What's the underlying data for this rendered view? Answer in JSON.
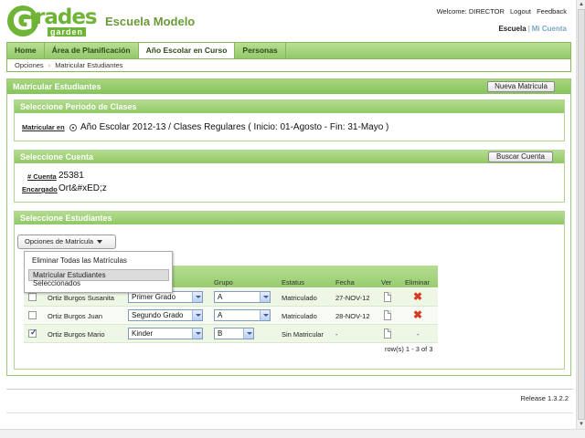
{
  "brand": {
    "logo_letter": "G",
    "logo_main": "rades",
    "logo_sub": "garden",
    "school_name": "Escuela Modelo"
  },
  "topbar": {
    "welcome": "Welcome: DIRECTOR",
    "logout": "Logout",
    "feedback": "Feedback"
  },
  "switcher": {
    "current": "Escuela",
    "separator": "|",
    "other": "Mi Cuenta"
  },
  "nav": {
    "tabs": [
      "Home",
      "Área de Planificación",
      "Año Escolar en Curso",
      "Personas"
    ],
    "active": 2
  },
  "breadcrumb": {
    "root": "Opciones",
    "arrow": "›",
    "current": "Matricular Estudiantes"
  },
  "main": {
    "title": "Matricular Estudiantes",
    "new_button": "Nueva Matricula"
  },
  "period": {
    "title": "Seleccione Periodo de Clases",
    "label": "Matricular en",
    "value": "Año Escolar 2012-13 / Clases Regulares ( Inicio: 01-Agosto - Fin: 31-Mayo )"
  },
  "account": {
    "title": "Seleccione Cuenta",
    "search_button": "Buscar Cuenta",
    "number_label": "# Cuenta",
    "number_value": "25381",
    "guardian_label": "Encargado",
    "guardian_value": "Ort&#xED;z"
  },
  "students": {
    "title": "Seleccione Estudiantes",
    "options_button": "Opciones de Matrícula",
    "menu": {
      "item1": "Eliminar Todas las Matrículas",
      "item2_line1": "Matrícular Estudiantes",
      "item2_line2": "Seleccionados"
    },
    "columns": {
      "grupo": "Grupo",
      "estatus": "Estatus",
      "fecha": "Fecha",
      "ver": "Ver",
      "eliminar": "Eliminar"
    },
    "rows": [
      {
        "checked": false,
        "name": "Ortiz Burgos Susanita",
        "grade": "Primer Grado",
        "group": "A",
        "status": "Matriculado",
        "date": "27-NOV-12",
        "delete": "✖"
      },
      {
        "checked": false,
        "name": "Ortiz Burgos Juan",
        "grade": "Segundo Grado",
        "group": "A",
        "status": "Matriculado",
        "date": "28-NOV-12",
        "delete": "✖"
      },
      {
        "checked": true,
        "name": "Ortiz Burgos Mario",
        "grade": "Kinder",
        "group": "B",
        "status": "Sin Matricular",
        "date": "-",
        "delete": "-"
      }
    ],
    "pager": "row(s) 1 - 3 of 3"
  },
  "footer": {
    "release": "Release 1.3.2.2"
  }
}
